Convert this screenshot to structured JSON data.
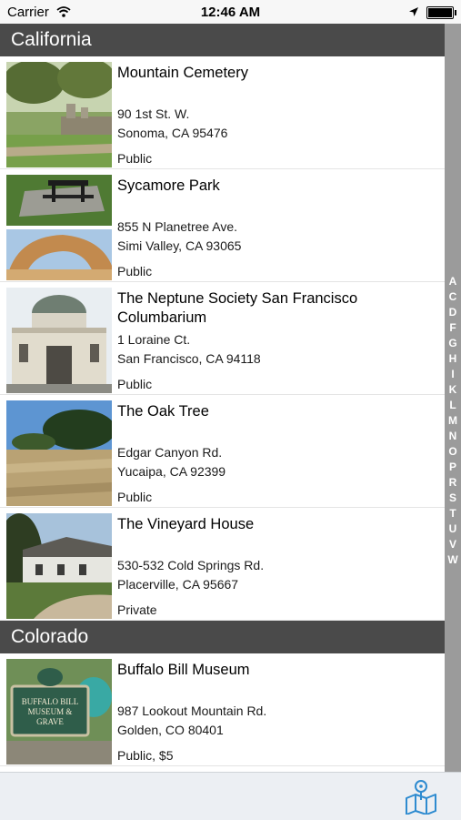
{
  "status_bar": {
    "carrier": "Carrier",
    "time": "12:46 AM"
  },
  "sections": [
    {
      "title": "California",
      "items": [
        {
          "name": "Mountain Cemetery",
          "address1": "90 1st St. W.",
          "address2": "Sonoma, CA 95476",
          "access": "Public"
        },
        {
          "name": "Sycamore Park",
          "address1": "855 N Planetree Ave.",
          "address2": "Simi Valley, CA 93065",
          "access": "Public"
        },
        {
          "name": "The Neptune Society San Francisco Columbarium",
          "address1": "1 Loraine Ct.",
          "address2": "San Francisco, CA 94118",
          "access": "Public"
        },
        {
          "name": "The Oak Tree",
          "address1": "Edgar Canyon Rd.",
          "address2": "Yucaipa, CA 92399",
          "access": "Public"
        },
        {
          "name": "The Vineyard House",
          "address1": "530-532 Cold Springs Rd.",
          "address2": "Placerville, CA 95667",
          "access": "Private"
        }
      ]
    },
    {
      "title": "Colorado",
      "items": [
        {
          "name": "Buffalo Bill Museum",
          "address1": "987 Lookout Mountain Rd.",
          "address2": "Golden, CO 80401",
          "access": "Public, $5"
        }
      ]
    }
  ],
  "thumbnail_signs": {
    "buffalo_bill": "BUFFALO BILL MUSEUM & GRAVE"
  },
  "index": [
    "A",
    "C",
    "D",
    "F",
    "G",
    "H",
    "I",
    "K",
    "L",
    "M",
    "N",
    "O",
    "P",
    "R",
    "S",
    "T",
    "U",
    "V",
    "W"
  ],
  "toolbar": {
    "map_icon": "map-icon"
  },
  "colors": {
    "section_header": "#4a4a4a",
    "index_bar": "#9b9b9b",
    "accent": "#2e8bd0"
  }
}
